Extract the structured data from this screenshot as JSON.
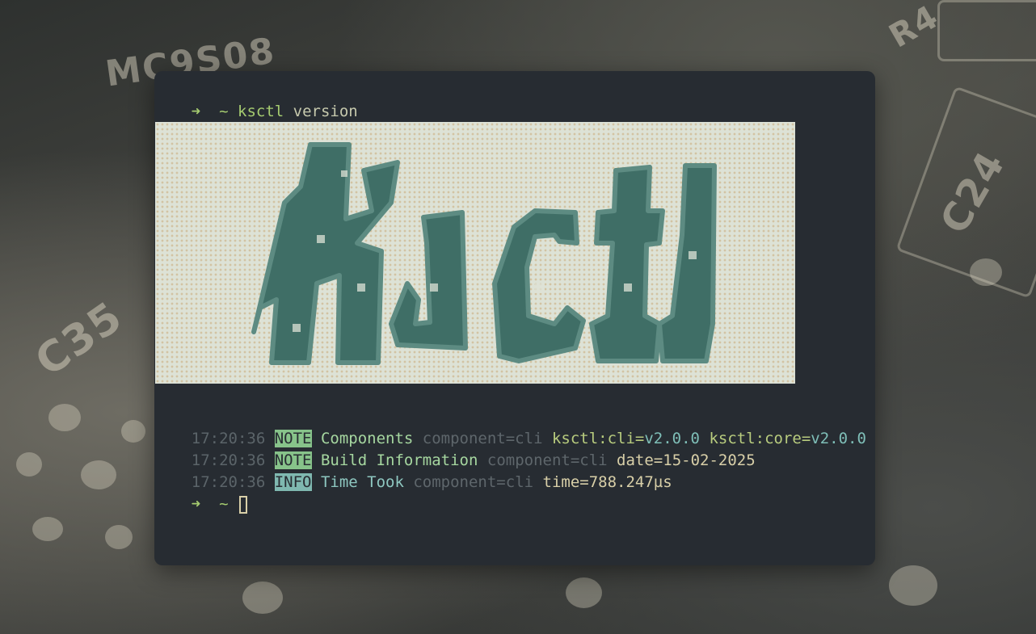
{
  "terminal": {
    "prompt_arrow": "➜",
    "prompt_dir": "~",
    "command": "ksctl",
    "command_arg": "version",
    "logo_text": "ksctl",
    "log_lines": [
      {
        "time": "17:20:36",
        "level": "NOTE",
        "message": "Components",
        "component": "component=cli",
        "fields": [
          {
            "key": "ksctl:cli=",
            "value": "v2.0.0"
          },
          {
            "key": "ksctl:core=",
            "value": "v2.0.0"
          }
        ]
      },
      {
        "time": "17:20:36",
        "level": "NOTE",
        "message": "Build Information",
        "component": "component=cli",
        "fields": [
          {
            "key": "date=",
            "value": "15-02-2025"
          }
        ]
      },
      {
        "time": "17:20:36",
        "level": "INFO",
        "message": "Time Took",
        "component": "component=cli",
        "fields": [
          {
            "key": "time=",
            "value": "788.247µs"
          }
        ]
      }
    ]
  },
  "wallpaper": {
    "chip_label_1": "MC9S08",
    "chip_label_2": "C35",
    "chip_label_3": "C24",
    "chip_label_4": "R4"
  },
  "colors": {
    "terminal_bg": "#272c32",
    "accent_green": "#a6cc70",
    "note_badge": "#87c38a",
    "info_badge": "#7fb8b0",
    "logo_dark": "#3f6e66"
  }
}
